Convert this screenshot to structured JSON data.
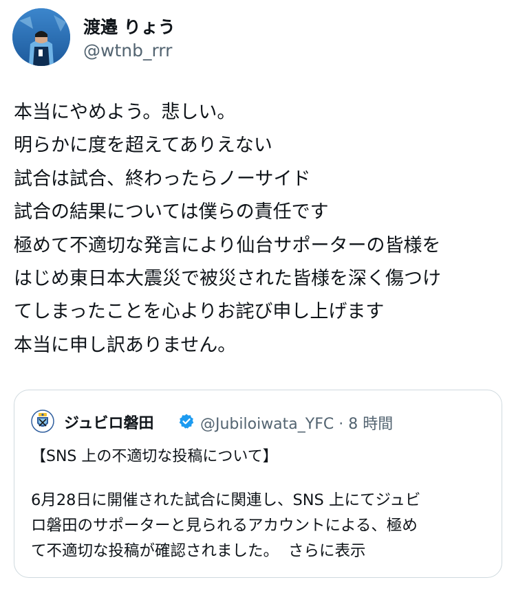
{
  "author": {
    "display_name": "渡邉 りょう",
    "handle": "@wtnb_rrr"
  },
  "tweet": {
    "lines": [
      "本当にやめよう。悲しい。",
      "明らかに度を超えてありえない",
      "試合は試合、終わったらノーサイド",
      "試合の結果については僕らの責任です",
      "極めて不適切な発言により仙台サポーターの皆様を",
      "はじめ東日本大震災で被災された皆様を深く傷つけ",
      "てしまったことを心よりお詫び申し上げます",
      "本当に申し訳ありません。"
    ]
  },
  "quote": {
    "name": "ジュビロ磐田",
    "handle": "@Jubiloiwata_YFC",
    "separator": "·",
    "time": "8 時間",
    "title": "【SNS 上の不適切な投稿について】",
    "body_lines": [
      "6月28日に開催された試合に関連し、SNS 上にてジュビ",
      "ロ磐田のサポーターと見られるアカウントによる、極め",
      "て不適切な投稿が確認されました。"
    ],
    "show_more": "さらに表示"
  },
  "icons": {
    "avatar": "profile-photo",
    "logo": "club-crest-icon",
    "verified": "verified-badge-icon"
  },
  "colors": {
    "text": "#0f1419",
    "secondary": "#536471",
    "border": "#cfd9de",
    "verified": "#1d9bf0"
  }
}
